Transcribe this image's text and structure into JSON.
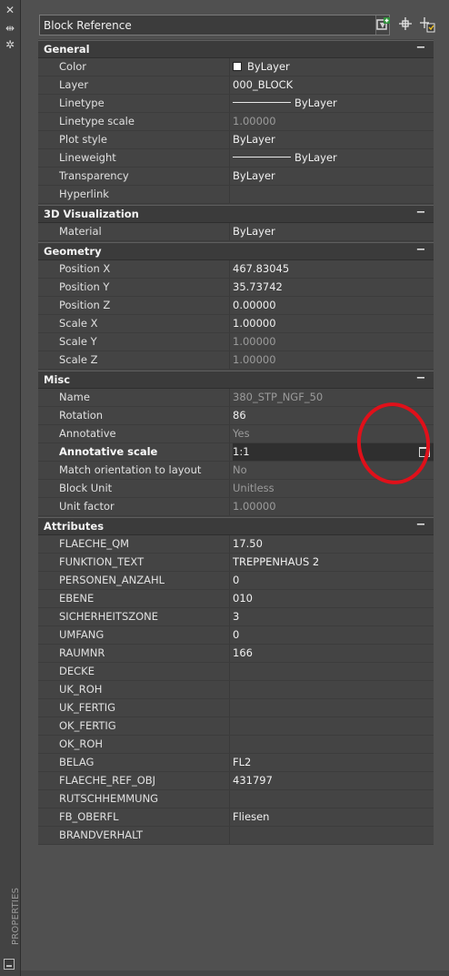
{
  "palette": {
    "label": "PROPERTIES",
    "icons": [
      "close-icon",
      "auto-hide-icon",
      "settings-icon"
    ]
  },
  "header": {
    "object_type": "Block Reference",
    "toolbar_icons": [
      "toggle-pickadd-icon",
      "select-objects-icon",
      "quick-select-icon"
    ]
  },
  "sections": [
    {
      "title": "General",
      "toggle": "−",
      "rows": [
        {
          "label": "Color",
          "value": "ByLayer",
          "kind": "color"
        },
        {
          "label": "Layer",
          "value": "000_BLOCK"
        },
        {
          "label": "Linetype",
          "value": "ByLayer",
          "kind": "line"
        },
        {
          "label": "Linetype scale",
          "value": "1.00000",
          "readonly": true
        },
        {
          "label": "Plot style",
          "value": "ByLayer"
        },
        {
          "label": "Lineweight",
          "value": "ByLayer",
          "kind": "line"
        },
        {
          "label": "Transparency",
          "value": "ByLayer"
        },
        {
          "label": "Hyperlink",
          "value": ""
        }
      ]
    },
    {
      "title": "3D Visualization",
      "toggle": "−",
      "rows": [
        {
          "label": "Material",
          "value": "ByLayer"
        }
      ]
    },
    {
      "title": "Geometry",
      "toggle": "−",
      "rows": [
        {
          "label": "Position X",
          "value": "467.83045"
        },
        {
          "label": "Position Y",
          "value": "35.73742"
        },
        {
          "label": "Position Z",
          "value": "0.00000"
        },
        {
          "label": "Scale X",
          "value": "1.00000"
        },
        {
          "label": "Scale Y",
          "value": "1.00000",
          "readonly": true
        },
        {
          "label": "Scale Z",
          "value": "1.00000",
          "readonly": true
        }
      ]
    },
    {
      "title": "Misc",
      "toggle": "−",
      "rows": [
        {
          "label": "Name",
          "value": "380_STP_NGF_50",
          "readonly": true
        },
        {
          "label": "Rotation",
          "value": "86"
        },
        {
          "label": "Annotative",
          "value": "Yes",
          "readonly": true
        },
        {
          "label": "Annotative scale",
          "value": "1:1",
          "selected": true,
          "bold": true,
          "picker": true
        },
        {
          "label": "Match orientation to layout",
          "value": "No",
          "readonly": true
        },
        {
          "label": "Block Unit",
          "value": "Unitless",
          "readonly": true
        },
        {
          "label": "Unit factor",
          "value": "1.00000",
          "readonly": true
        }
      ]
    },
    {
      "title": "Attributes",
      "toggle": "−",
      "rows": [
        {
          "label": "FLAECHE_QM",
          "value": "17.50"
        },
        {
          "label": "FUNKTION_TEXT",
          "value": "TREPPENHAUS 2"
        },
        {
          "label": "PERSONEN_ANZAHL",
          "value": "0"
        },
        {
          "label": "EBENE",
          "value": "010"
        },
        {
          "label": "SICHERHEITSZONE",
          "value": "3"
        },
        {
          "label": "UMFANG",
          "value": "0"
        },
        {
          "label": "RAUMNR",
          "value": "166"
        },
        {
          "label": "DECKE",
          "value": ""
        },
        {
          "label": "UK_ROH",
          "value": ""
        },
        {
          "label": "UK_FERTIG",
          "value": ""
        },
        {
          "label": "OK_FERTIG",
          "value": ""
        },
        {
          "label": "OK_ROH",
          "value": ""
        },
        {
          "label": "BELAG",
          "value": "FL2"
        },
        {
          "label": "FLAECHE_REF_OBJ",
          "value": "431797"
        },
        {
          "label": "RUTSCHHEMMUNG",
          "value": ""
        },
        {
          "label": "FB_OBERFL",
          "value": "Fliesen"
        },
        {
          "label": "BRANDVERHALT",
          "value": ""
        }
      ]
    }
  ],
  "annotation": {
    "shape": "red-circle",
    "color": "#e0101a"
  }
}
